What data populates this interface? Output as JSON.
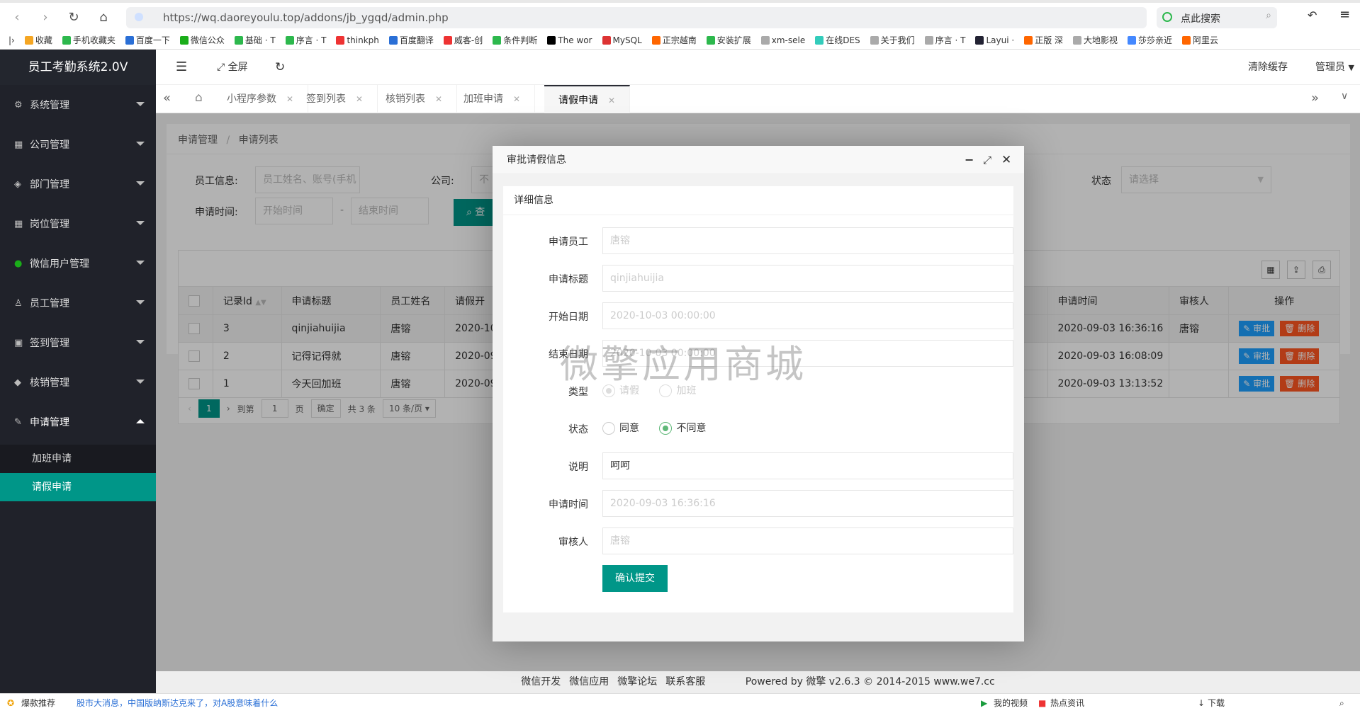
{
  "browser": {
    "url": "https://wq.daoreyoulu.top/addons/jb_ygqd/admin.php",
    "search_placeholder": "点此搜索",
    "bookmarks": [
      "收藏",
      "手机收藏夹",
      "百度一下",
      "微信公众",
      "基础 · T",
      "序言 · T",
      "thinkph",
      "百度翻译",
      "威客-创",
      "条件判断",
      "The wor",
      "MySQL",
      "正宗越南",
      "安装扩展",
      "xm-sele",
      "在线DES",
      "关于我们",
      "序言 · T",
      "Layui ·",
      "正版 深",
      "大地影视",
      "莎莎亲近",
      "阿里云"
    ]
  },
  "sidebar": {
    "title": "员工考勤系统2.0V",
    "items": [
      {
        "label": "系统管理",
        "icon": "gear-icon"
      },
      {
        "label": "公司管理",
        "icon": "grid-icon"
      },
      {
        "label": "部门管理",
        "icon": "layers-icon"
      },
      {
        "label": "岗位管理",
        "icon": "grid-icon"
      },
      {
        "label": "微信用户管理",
        "icon": "wechat-icon"
      },
      {
        "label": "员工管理",
        "icon": "user-icon"
      },
      {
        "label": "签到管理",
        "icon": "calendar-icon"
      },
      {
        "label": "核销管理",
        "icon": "diamond-icon"
      },
      {
        "label": "申请管理",
        "icon": "edit-icon"
      }
    ],
    "sub_items": [
      {
        "label": "加班申请"
      },
      {
        "label": "请假申请"
      }
    ]
  },
  "header": {
    "fullscreen": "全屏",
    "clear_cache": "清除缓存",
    "user": "管理员"
  },
  "tabs": [
    {
      "label": "小程序参数"
    },
    {
      "label": "签到列表"
    },
    {
      "label": "核销列表"
    },
    {
      "label": "加班申请"
    },
    {
      "label": "请假申请",
      "active": true
    }
  ],
  "breadcrumb": [
    "申请管理",
    "申请列表"
  ],
  "filters": {
    "employee_label": "员工信息:",
    "employee_placeholder": "员工姓名、账号(手机号)",
    "company_label": "公司:",
    "company_placeholder": "不",
    "status_label": "状态",
    "status_placeholder": "请选择",
    "time_label": "申请时间:",
    "start_placeholder": "开始时间",
    "end_placeholder": "结束时间",
    "search_button": "查"
  },
  "table": {
    "columns": [
      "记录Id",
      "申请标题",
      "员工姓名",
      "请假开",
      "申请时间",
      "审核人",
      "操作"
    ],
    "rows": [
      {
        "id": "3",
        "title": "qinjiahuijia",
        "name": "唐镕",
        "start": "2020-10",
        "apply_time": "2020-09-03 16:36:16",
        "reviewer": "唐镕"
      },
      {
        "id": "2",
        "title": "记得记得就",
        "name": "唐镕",
        "start": "2020-09",
        "apply_time": "2020-09-03 16:08:09",
        "reviewer": ""
      },
      {
        "id": "1",
        "title": "今天回加班",
        "name": "唐镕",
        "start": "2020-09",
        "apply_time": "2020-09-03 13:13:52",
        "reviewer": ""
      }
    ],
    "approve": "审批",
    "delete": "删除"
  },
  "pagination": {
    "current": "1",
    "goto": "到第",
    "page_value": "1",
    "page": "页",
    "confirm": "确定",
    "total": "共 3 条",
    "per_page": "10 条/页"
  },
  "modal": {
    "title": "审批请假信息",
    "section": "详细信息",
    "fields": {
      "employee_label": "申请员工",
      "employee": "唐镕",
      "title_label": "申请标题",
      "title": "qinjiahuijia",
      "start_label": "开始日期",
      "start": "2020-10-03 00:00:00",
      "end_label": "结束日期",
      "end": "2020-10-03 00:00:00",
      "type_label": "类型",
      "type_options": [
        "请假",
        "加班"
      ],
      "status_label": "状态",
      "status_options": [
        "同意",
        "不同意"
      ],
      "note_label": "说明",
      "note": "呵呵",
      "apply_time_label": "申请时间",
      "apply_time": "2020-09-03 16:36:16",
      "reviewer_label": "审核人",
      "reviewer": "唐镕"
    },
    "submit": "确认提交"
  },
  "watermark": "微擎应用商城",
  "footer": {
    "links": [
      "微信开发",
      "微信应用",
      "微擎论坛",
      "联系客服"
    ],
    "powered": "Powered by 微擎 v2.6.3 © 2014-2015 www.we7.cc"
  },
  "statusbar": {
    "left": "爆款推荐",
    "news": "股市大消息，中国版纳斯达克来了，对A股意味着什么",
    "video": "我的视频",
    "hot": "热点资讯",
    "download": "下载"
  },
  "colors": {
    "sidebar": "#20222a",
    "accent": "#009688",
    "approve": "#1E9FFF",
    "delete": "#FF5722"
  }
}
